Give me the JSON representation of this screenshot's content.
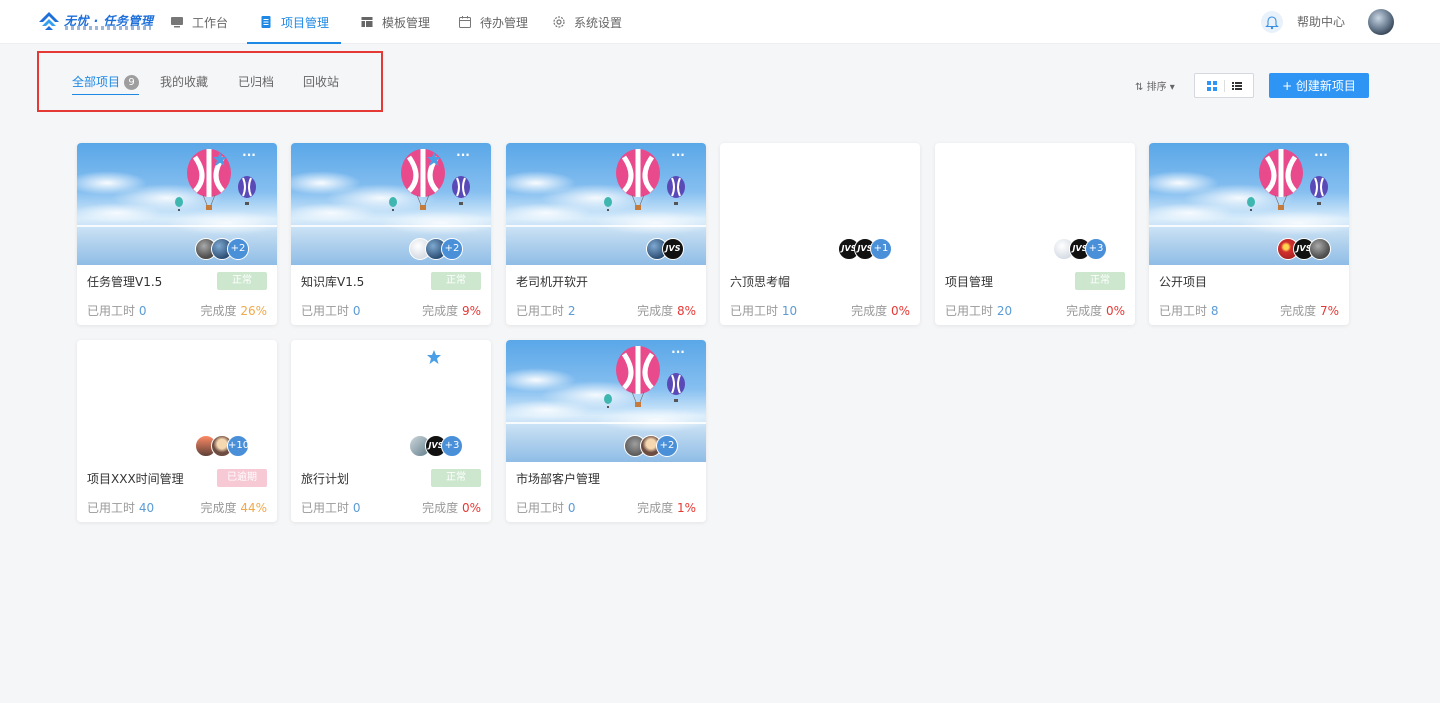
{
  "app": {
    "logo_text": "无忧 · 任务管理"
  },
  "nav": {
    "items": [
      {
        "label": "工作台"
      },
      {
        "label": "项目管理"
      },
      {
        "label": "模板管理"
      },
      {
        "label": "待办管理"
      },
      {
        "label": "系统设置"
      }
    ],
    "help_label": "帮助中心"
  },
  "filters": {
    "tabs": [
      {
        "label": "全部项目",
        "count": "9"
      },
      {
        "label": "我的收藏"
      },
      {
        "label": "已归档"
      },
      {
        "label": "回收站"
      }
    ],
    "sort_label": "排序",
    "create_label": "+ 创建新项目"
  },
  "labels": {
    "hours": "已用工时",
    "progress": "完成度"
  },
  "colors": {
    "accent": "#1e88e5",
    "primary_button": "#2f95f5",
    "highlight_border": "#e53935"
  },
  "projects": [
    {
      "title": "任务管理V1.5",
      "status": "正常",
      "hours": "0",
      "progress": "26%",
      "more": "+2"
    },
    {
      "title": "知识库V1.5",
      "status": "正常",
      "hours": "0",
      "progress": "9%",
      "more": "+2"
    },
    {
      "title": "老司机开软开",
      "hours": "2",
      "progress": "8%",
      "avatar_text": "JVS"
    },
    {
      "title": "六顶思考帽",
      "hours": "10",
      "progress": "0%",
      "avatar_text": "JVS",
      "more": "+1"
    },
    {
      "title": "项目管理",
      "status": "正常",
      "hours": "20",
      "progress": "0%",
      "avatar_text": "JVS",
      "more": "+3"
    },
    {
      "title": "公开项目",
      "hours": "8",
      "progress": "7%",
      "avatar_text": "JVS"
    },
    {
      "title": "项目XXX时间管理",
      "status": "已逾期",
      "hours": "40",
      "progress": "44%",
      "more": "+10"
    },
    {
      "title": "旅行计划",
      "status": "正常",
      "hours": "0",
      "progress": "0%",
      "avatar_text": "JVS",
      "more": "+3"
    },
    {
      "title": "市场部客户管理",
      "hours": "0",
      "progress": "1%",
      "more": "+2"
    }
  ]
}
